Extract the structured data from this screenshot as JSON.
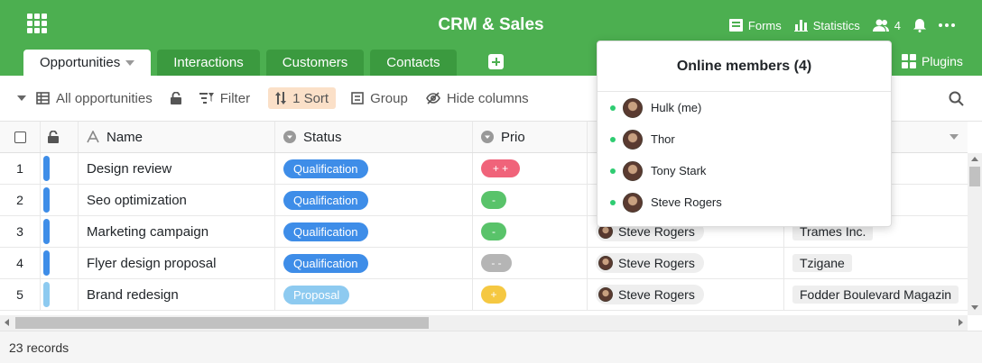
{
  "header": {
    "title": "CRM & Sales",
    "tools": [
      {
        "icon": "forms-icon",
        "label": "Forms"
      },
      {
        "icon": "statistics-icon",
        "label": "Statistics"
      },
      {
        "icon": "members-icon",
        "label": "4"
      }
    ],
    "plugins_label": "Plugins"
  },
  "tabs": [
    {
      "label": "Opportunities",
      "active": true
    },
    {
      "label": "Interactions",
      "active": false
    },
    {
      "label": "Customers",
      "active": false
    },
    {
      "label": "Contacts",
      "active": false
    }
  ],
  "toolbar": {
    "view_label": "All opportunities",
    "filter_label": "Filter",
    "sort_label": "1 Sort",
    "group_label": "Group",
    "hide_columns_label": "Hide columns"
  },
  "columns": {
    "name": "Name",
    "status": "Status",
    "prio": "Prio"
  },
  "rows": [
    {
      "index": "1",
      "color": "#3e8de8",
      "name": "Design review",
      "status": "Qualification",
      "status_color": "#3e8de8",
      "prio": "+ +",
      "prio_color": "#f0637a",
      "owner": "",
      "company": ""
    },
    {
      "index": "2",
      "color": "#3e8de8",
      "name": "Seo optimization",
      "status": "Qualification",
      "status_color": "#3e8de8",
      "prio": "-",
      "prio_color": "#59c36a",
      "owner": "",
      "company": ""
    },
    {
      "index": "3",
      "color": "#3e8de8",
      "name": "Marketing campaign",
      "status": "Qualification",
      "status_color": "#3e8de8",
      "prio": "-",
      "prio_color": "#59c36a",
      "owner": "Steve Rogers",
      "company": "Trames Inc."
    },
    {
      "index": "4",
      "color": "#3e8de8",
      "name": "Flyer design proposal",
      "status": "Qualification",
      "status_color": "#3e8de8",
      "prio": "- -",
      "prio_color": "#b5b5b5",
      "owner": "Steve Rogers",
      "company": "Tzigane"
    },
    {
      "index": "5",
      "color": "#8dcaf0",
      "name": "Brand redesign",
      "status": "Proposal",
      "status_color": "#8dcaf0",
      "prio": "+",
      "prio_color": "#f5c842",
      "owner": "Steve Rogers",
      "company": "Fodder Boulevard Magazin"
    }
  ],
  "footer": {
    "records": "23 records"
  },
  "online_members": {
    "title": "Online members (4)",
    "members": [
      "Hulk (me)",
      "Thor",
      "Tony Stark",
      "Steve Rogers"
    ]
  }
}
